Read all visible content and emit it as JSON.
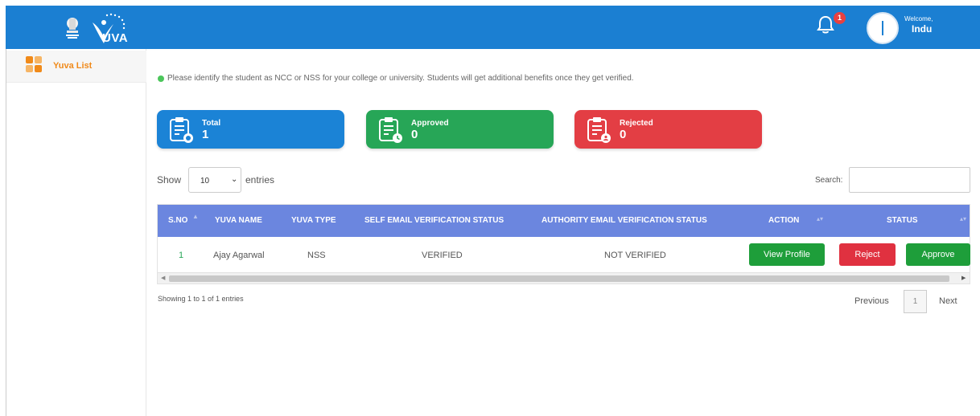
{
  "header": {
    "brand": "UVA",
    "notification_count": "1",
    "welcome": "Welcome,",
    "username": "Indu",
    "accent_color": "#1b7fd2"
  },
  "sidebar": {
    "items": [
      {
        "label": "Yuva List",
        "icon": "grid-icon",
        "color": "#f08a1a"
      }
    ]
  },
  "main": {
    "notice": "Please identify the student as NCC or NSS for your college or university. Students will get additional benefits once they get verified.",
    "cards": {
      "total": {
        "label": "Total",
        "value": "1",
        "icon": "clipboard-icon",
        "color": "#1b83d6"
      },
      "approved": {
        "label": "Approved",
        "value": "0",
        "icon": "clipboard-clock-icon",
        "color": "#27a657"
      },
      "rejected": {
        "label": "Rejected",
        "value": "0",
        "icon": "clipboard-user-icon",
        "color": "#e33e44"
      }
    },
    "length": {
      "show": "Show",
      "value": "10",
      "entries": "entries"
    },
    "search": {
      "label": "Search:",
      "value": ""
    },
    "table": {
      "columns": [
        "S.NO",
        "YUVA NAME",
        "YUVA TYPE",
        "SELF EMAIL VERIFICATION STATUS",
        "AUTHORITY EMAIL VERIFICATION STATUS",
        "ACTION",
        "STATUS"
      ],
      "rows": [
        {
          "sno": "1",
          "name": "Ajay Agarwal",
          "type": "NSS",
          "self_status": "VERIFIED",
          "authority_status": "NOT VERIFIED",
          "action": "View Profile",
          "reject": "Reject",
          "approve": "Approve"
        }
      ]
    },
    "info": "Showing 1 to 1 of 1 entries",
    "pagination": {
      "previous": "Previous",
      "page": "1",
      "next": "Next"
    }
  }
}
